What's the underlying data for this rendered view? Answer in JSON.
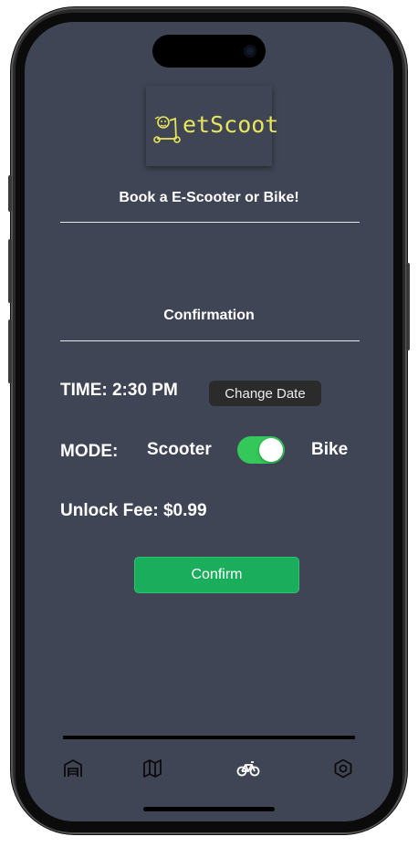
{
  "brand": {
    "logo_text": "etScoot",
    "accent_color": "#e7e65a"
  },
  "header": {
    "tagline": "Book a E-Scooter or Bike!"
  },
  "section": {
    "title": "Confirmation"
  },
  "time": {
    "label": "TIME: 2:30 PM",
    "change_button": "Change Date"
  },
  "mode": {
    "label": "MODE:",
    "option_left": "Scooter",
    "option_right": "Bike",
    "toggle_on": true,
    "toggle_color": "#34c759"
  },
  "fee": {
    "label": "Unlock Fee: $0.99"
  },
  "actions": {
    "confirm_label": "Confirm",
    "confirm_color": "#1aae5c"
  },
  "nav": {
    "items": [
      {
        "icon": "garage-icon",
        "active": false
      },
      {
        "icon": "map-icon",
        "active": false
      },
      {
        "icon": "bike-icon",
        "active": true
      },
      {
        "icon": "settings-icon",
        "active": false
      }
    ]
  },
  "theme": {
    "screen_bg": "#3f4554"
  }
}
